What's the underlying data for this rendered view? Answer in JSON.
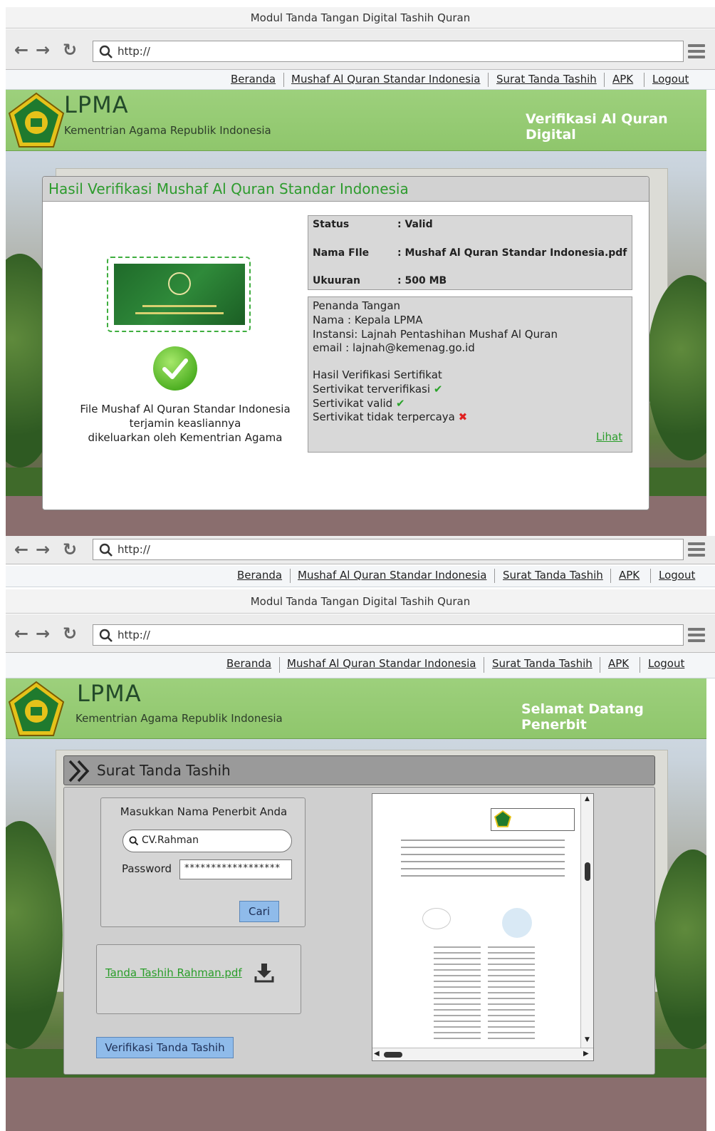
{
  "window": {
    "title": "Modul Tanda Tangan Digital Tashih Quran",
    "url": "http://"
  },
  "menu": [
    "Beranda",
    "Mushaf Al Quran Standar Indonesia",
    "Surat Tanda Tashih",
    "APK",
    "Logout"
  ],
  "header": {
    "title": "LPMA",
    "subtitle": "Kementrian Agama Republik Indonesia"
  },
  "screen1": {
    "banner_right": "Verifikasi Al Quran Digital",
    "panel_title": "Hasil Verifikasi Mushaf Al Quran Standar Indonesia",
    "file_info": [
      {
        "label": "Status",
        "value": ": Valid"
      },
      {
        "label": "Nama FIle",
        "value": ": Mushaf Al Quran Standar Indonesia.pdf"
      },
      {
        "label": "Ukuuran",
        "value": ": 500 MB"
      }
    ],
    "signer": {
      "heading": "Penanda Tangan",
      "name": "Nama    : Kepala LPMA",
      "agency": "Instansi: Lajnah Pentashihan Mushaf Al Quran",
      "email": "email     : lajnah@kemenag.go.id"
    },
    "cert": {
      "heading": "Hasil Verifikasi Sertifikat",
      "verified": "Sertivikat terverifikasi",
      "valid": "Sertivikat valid",
      "untrusted": "Sertivikat tidak terpercaya"
    },
    "view_link": "Lihat",
    "caption_lines": [
      "File Mushaf Al Quran Standar Indonesia",
      "terjamin keasliannya",
      "dikeluarkan oleh Kementrian Agama"
    ]
  },
  "screen2": {
    "banner_right": "Selamat Datang Penerbit",
    "section_title": "Surat Tanda Tashih",
    "form_title": "Masukkan Nama Penerbit Anda",
    "search_value": "CV.Rahman",
    "password_label": "Password",
    "password_value": "******************",
    "search_button": "Cari",
    "file_link": "Tanda Tashih Rahman.pdf",
    "verify_button": "Verifikasi Tanda Tashih"
  },
  "colors": {
    "banner_green": "#8fc66c",
    "accent_green": "#2d9b2d",
    "button_blue": "#8fbbea"
  }
}
